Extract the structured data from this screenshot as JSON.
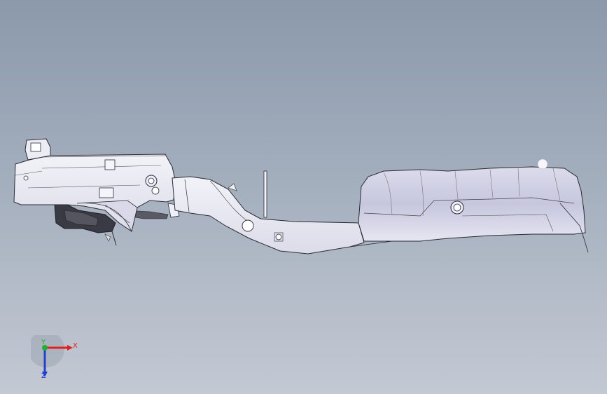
{
  "viewport": {
    "background_top": "#8b99ab",
    "background_bottom": "#c3c9d3",
    "model": {
      "part_fill": "#e9eaf3",
      "part_shade": "#c9c9e2",
      "edge_color": "#2a2a33",
      "dark_component": "#3a3a44"
    }
  },
  "triad": {
    "x_label": "X",
    "y_label": "Y",
    "z_label": "Z",
    "x_color": "#e02020",
    "y_color": "#20b030",
    "z_color": "#2040d0"
  }
}
